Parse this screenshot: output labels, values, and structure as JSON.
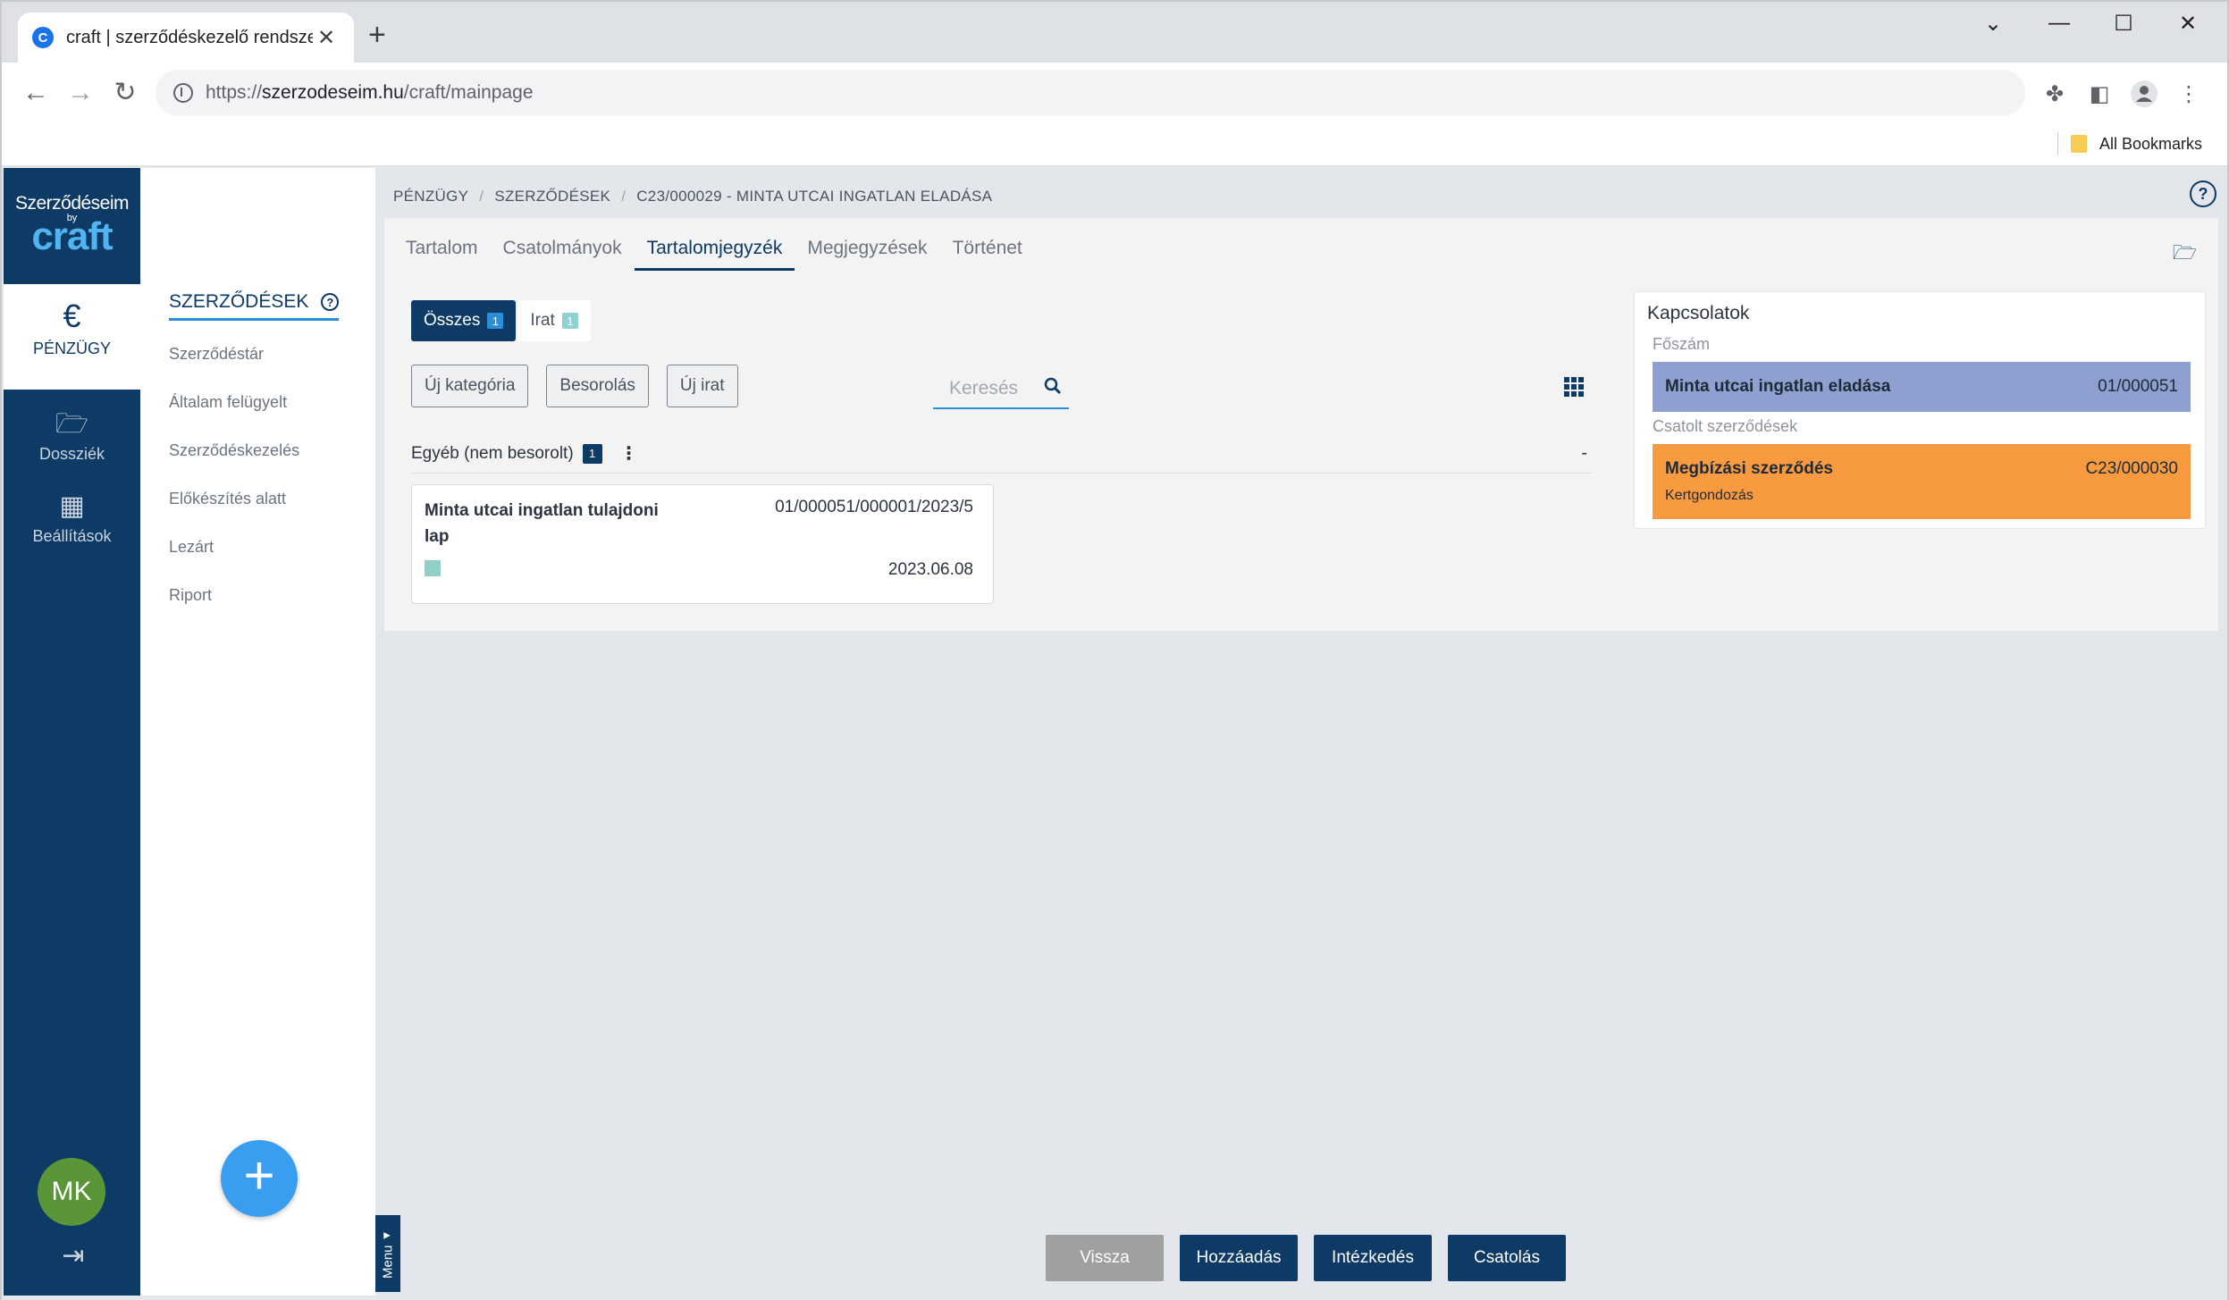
{
  "browser": {
    "tab_title": "craft | szerződéskezelő rendszer",
    "favicon_letter": "C",
    "url_prefix": "https://",
    "url_host": "szerzodeseim.hu",
    "url_path": "/craft/mainpage",
    "bookmarks_label": "All Bookmarks"
  },
  "logo": {
    "line1": "Szerződéseim",
    "line2": "by",
    "line3": "craft"
  },
  "leftnav": {
    "items": [
      {
        "label": "PÉNZÜGY",
        "icon": "euro-icon",
        "active": true
      },
      {
        "label": "Dossziék",
        "icon": "folder-open-icon",
        "active": false
      },
      {
        "label": "Beállítások",
        "icon": "building-icon",
        "active": false
      }
    ],
    "avatar_initials": "MK"
  },
  "subnav": {
    "heading": "SZERZŐDÉSEK",
    "items": [
      "Szerződéstár",
      "Általam felügyelt",
      "Szerződéskezelés",
      "Előkészítés alatt",
      "Lezárt",
      "Riport"
    ]
  },
  "breadcrumb": [
    "PÉNZÜGY",
    "SZERZŐDÉSEK",
    "C23/000029 - MINTA UTCAI INGATLAN ELADÁSA"
  ],
  "tabs": [
    "Tartalom",
    "Csatolmányok",
    "Tartalomjegyzék",
    "Megjegyzések",
    "Történet"
  ],
  "active_tab": "Tartalomjegyzék",
  "filters": [
    {
      "label": "Összes",
      "count": "1"
    },
    {
      "label": "Irat",
      "count": "1"
    }
  ],
  "actions": [
    "Új kategória",
    "Besorolás",
    "Új irat"
  ],
  "search": {
    "placeholder": "Keresés"
  },
  "category": {
    "name": "Egyéb (nem besorolt)",
    "count": "1",
    "collapse": "-"
  },
  "document": {
    "title": "Minta utcai ingatlan tulajdoni lap",
    "code": "01/000051/000001/2023/5",
    "date": "2023.06.08"
  },
  "relations": {
    "title": "Kapcsolatok",
    "main_label": "Főszám",
    "main_name": "Minta utcai ingatlan eladása",
    "main_code": "01/000051",
    "linked_label": "Csatolt szerződések",
    "linked_name": "Megbízási szerződés",
    "linked_code": "C23/000030",
    "linked_sub": "Kertgondozás"
  },
  "menu_tab": "Menu",
  "bottom_buttons": [
    "Vissza",
    "Hozzáadás",
    "Intézkedés",
    "Csatolás"
  ],
  "colors": {
    "navy": "#0e3a66",
    "accent_blue": "#2a8fd8",
    "main_box": "#8f9fcf",
    "linked_box": "#f79a40",
    "avatar": "#5a9638"
  }
}
